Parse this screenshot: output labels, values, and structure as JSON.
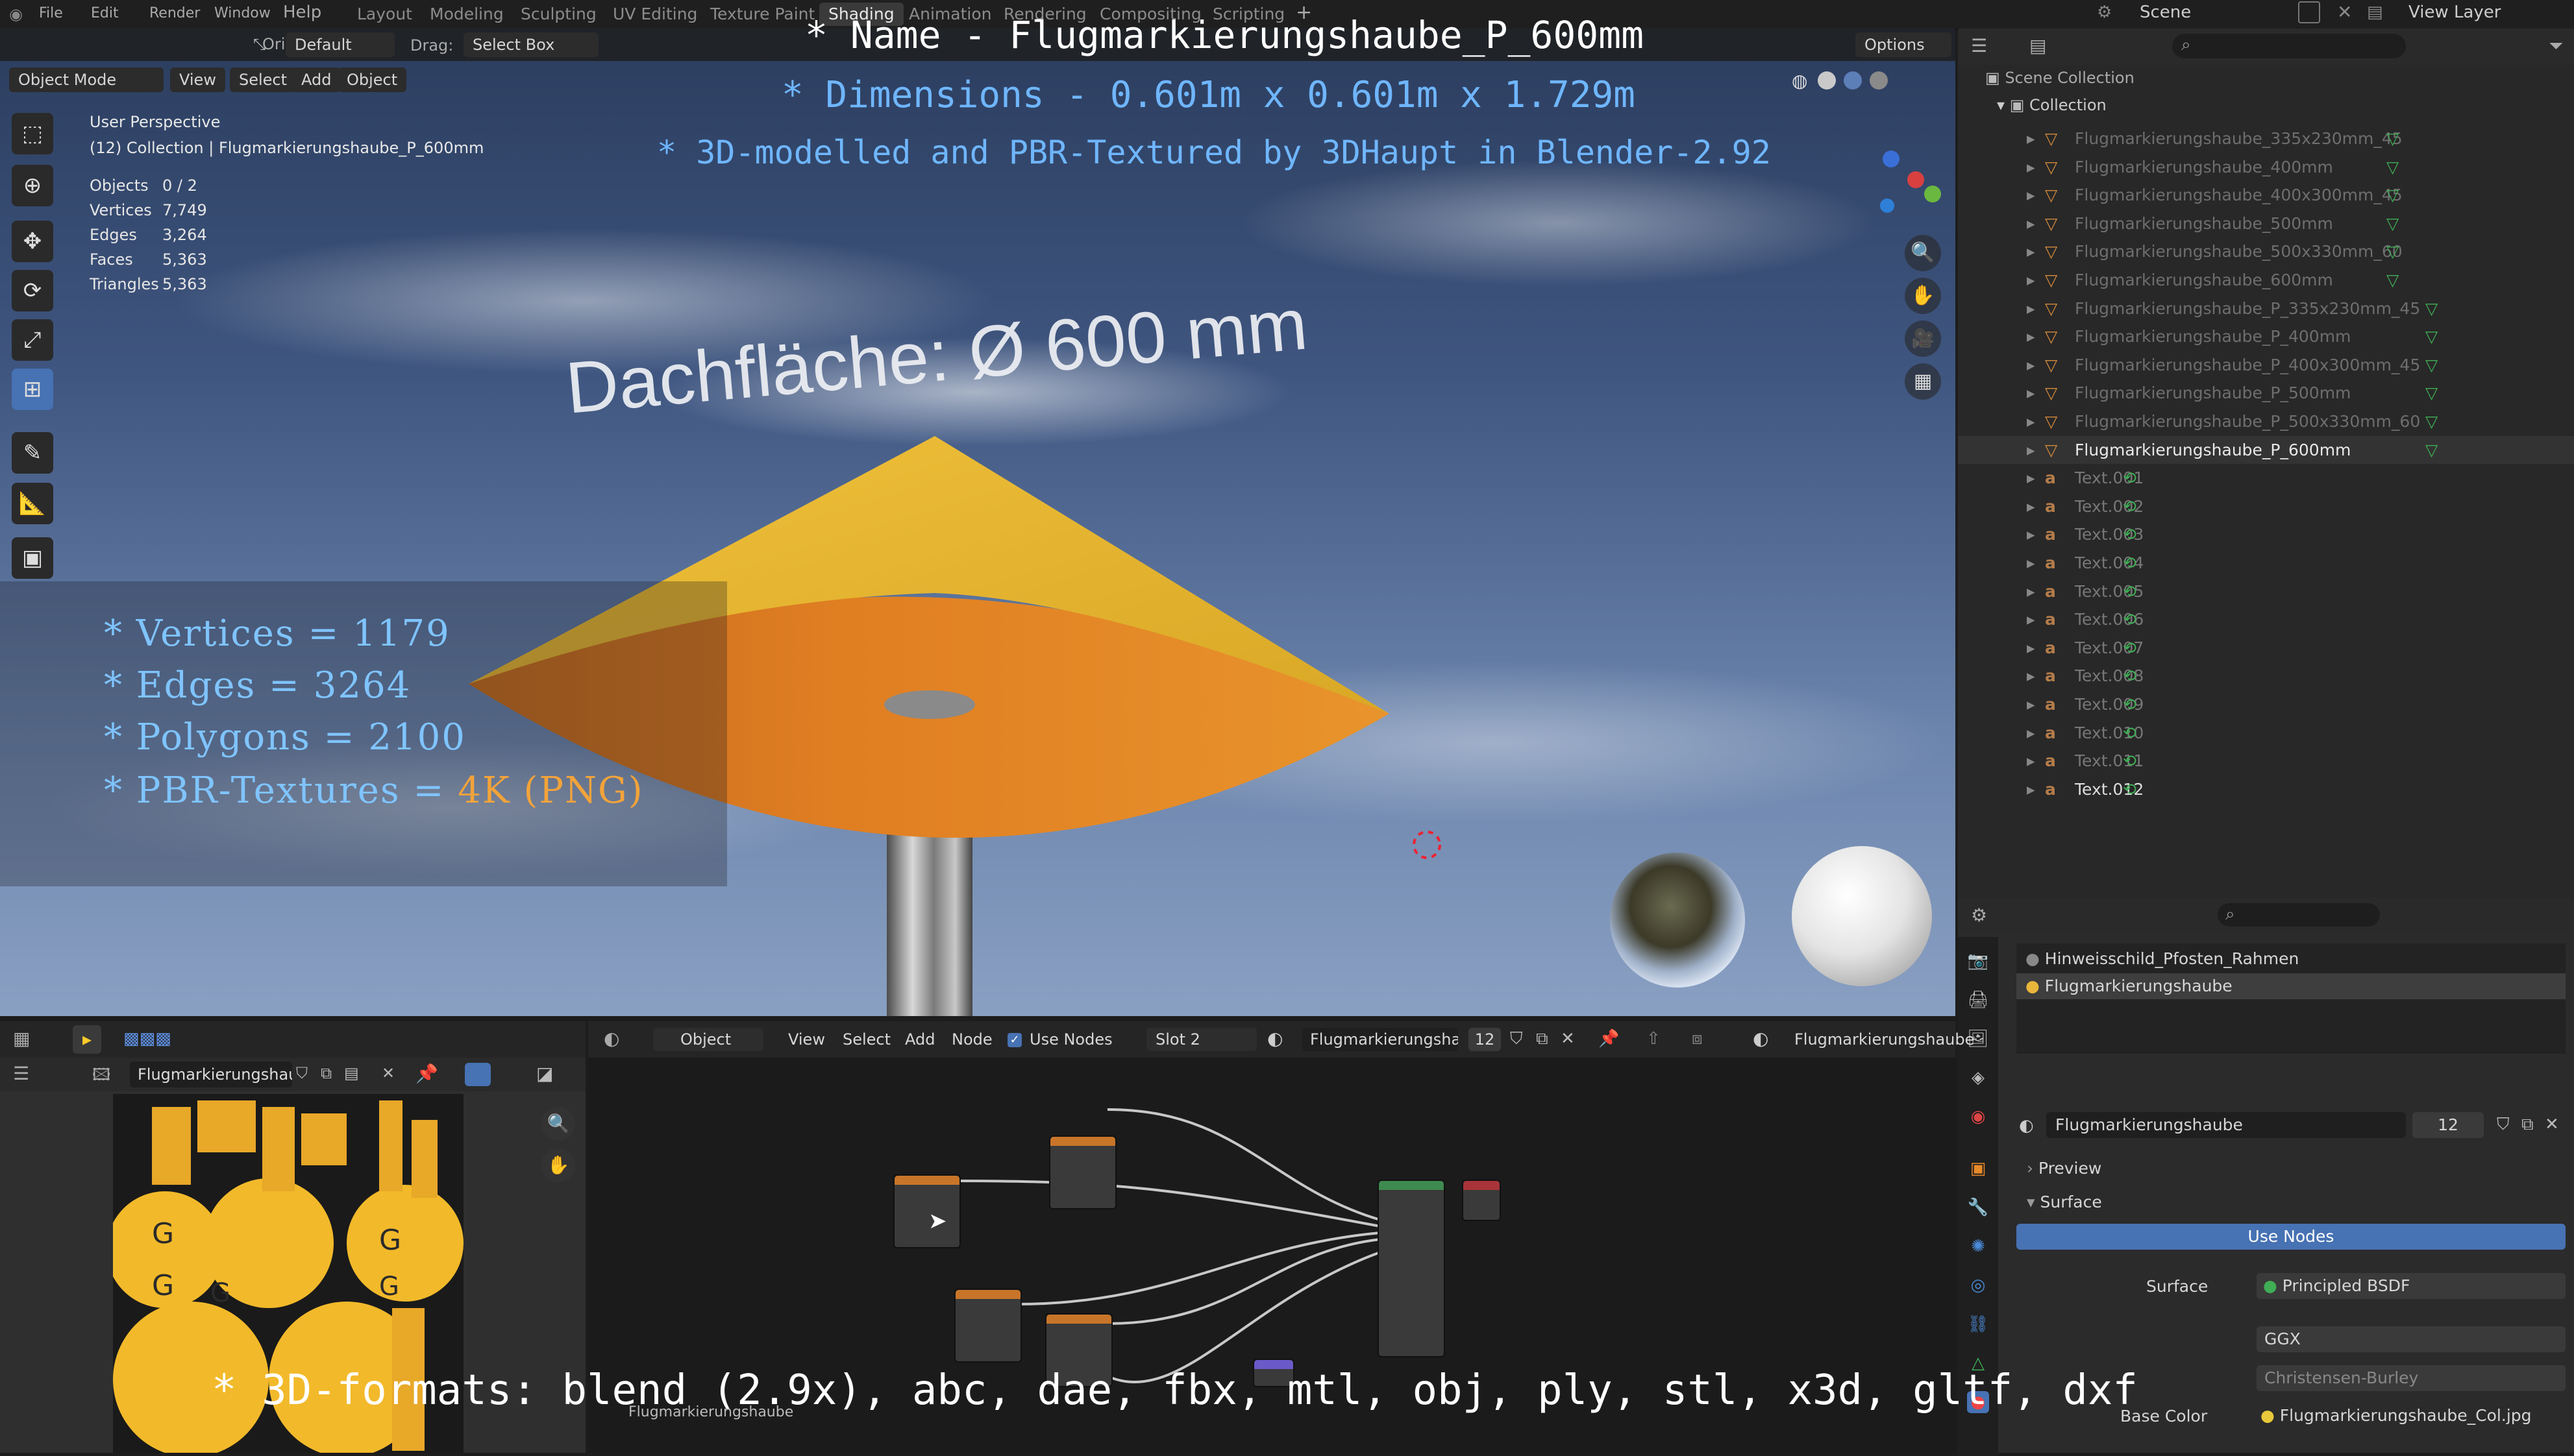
{
  "topbar": {
    "menus": [
      "File",
      "Edit",
      "Render",
      "Window",
      "Help"
    ],
    "workspace_tabs": [
      "Layout",
      "Modeling",
      "Sculpting",
      "UV Editing",
      "Texture Paint",
      "Shading",
      "Animation",
      "Rendering",
      "Compositing",
      "Scripting"
    ],
    "active_tab": "Shading",
    "scene_label": "Scene",
    "view_layer_label": "View Layer"
  },
  "viewport": {
    "header": {
      "mode": "Object Mode",
      "view": "View",
      "select": "Select",
      "add": "Add",
      "object": "Object",
      "orientation_label": "Orientation:",
      "orientation_value": "Default",
      "drag_label": "Drag:",
      "drag_value": "Select Box",
      "options_label": "Options"
    },
    "perspective_label": "User Perspective",
    "collection_label": "(12) Collection | Flugmarkierungshaube_P_600mm",
    "stats": [
      {
        "label": "Objects",
        "value": "0 / 2"
      },
      {
        "label": "Vertices",
        "value": "7,749"
      },
      {
        "label": "Edges",
        "value": "3,264"
      },
      {
        "label": "Faces",
        "value": "5,363"
      },
      {
        "label": "Triangles",
        "value": "5,363"
      }
    ],
    "scene_text_3d": "Dachfläche:  Ø 600 mm",
    "overlay_title": "* Name - Flugmarkierungshaube_P_600mm",
    "overlay_dimensions": "* Dimensions -  0.601m x 0.601m x 1.729m",
    "overlay_credit": "* 3D-modelled and PBR-Textured by 3DHaupt in Blender-2.92",
    "spec_lines": [
      {
        "prefix": "* Vertices = ",
        "value": "1179"
      },
      {
        "prefix": "* Edges = ",
        "value": "3264"
      },
      {
        "prefix": "* Polygons = ",
        "value": "2100"
      },
      {
        "prefix": "* PBR-Textures = ",
        "value": "4K (PNG)"
      }
    ],
    "formats_line": "* 3D-formats: blend (2.9x), abc, dae, fbx, mtl, obj, ply, stl, x3d, gltf, dxf"
  },
  "outliner": {
    "scene_collection": "Scene Collection",
    "collection": "Collection",
    "items": [
      {
        "name": "Flugmarkierungshaube_335x230mm_45",
        "kind": "mesh",
        "state": "dim"
      },
      {
        "name": "Flugmarkierungshaube_400mm",
        "kind": "mesh",
        "state": "dim"
      },
      {
        "name": "Flugmarkierungshaube_400x300mm_45",
        "kind": "mesh",
        "state": "dim"
      },
      {
        "name": "Flugmarkierungshaube_500mm",
        "kind": "mesh",
        "state": "dim"
      },
      {
        "name": "Flugmarkierungshaube_500x330mm_60",
        "kind": "mesh",
        "state": "dim"
      },
      {
        "name": "Flugmarkierungshaube_600mm",
        "kind": "mesh",
        "state": "dim"
      },
      {
        "name": "Flugmarkierungshaube_P_335x230mm_45",
        "kind": "mesh",
        "state": "dim"
      },
      {
        "name": "Flugmarkierungshaube_P_400mm",
        "kind": "mesh",
        "state": "dim"
      },
      {
        "name": "Flugmarkierungshaube_P_400x300mm_45",
        "kind": "mesh",
        "state": "dim"
      },
      {
        "name": "Flugmarkierungshaube_P_500mm",
        "kind": "mesh",
        "state": "dim"
      },
      {
        "name": "Flugmarkierungshaube_P_500x330mm_60",
        "kind": "mesh",
        "state": "dim"
      },
      {
        "name": "Flugmarkierungshaube_P_600mm",
        "kind": "mesh",
        "state": "sel"
      },
      {
        "name": "Text.001",
        "kind": "text",
        "state": "dim"
      },
      {
        "name": "Text.002",
        "kind": "text",
        "state": "dim"
      },
      {
        "name": "Text.003",
        "kind": "text",
        "state": "dim"
      },
      {
        "name": "Text.004",
        "kind": "text",
        "state": "dim"
      },
      {
        "name": "Text.005",
        "kind": "text",
        "state": "dim"
      },
      {
        "name": "Text.006",
        "kind": "text",
        "state": "dim"
      },
      {
        "name": "Text.007",
        "kind": "text",
        "state": "dim"
      },
      {
        "name": "Text.008",
        "kind": "text",
        "state": "dim"
      },
      {
        "name": "Text.009",
        "kind": "text",
        "state": "dim"
      },
      {
        "name": "Text.010",
        "kind": "text",
        "state": "dim"
      },
      {
        "name": "Text.011",
        "kind": "text",
        "state": "dim"
      },
      {
        "name": "Text.012",
        "kind": "text",
        "state": "last"
      }
    ]
  },
  "properties": {
    "material_slots": [
      "Hinweisschild_Pfosten_Rahmen",
      "Flugmarkierungshaube"
    ],
    "material_name": "Flugmarkierungshaube",
    "material_users": "12",
    "preview_label": "Preview",
    "surface_panel": "Surface",
    "use_nodes_button": "Use Nodes",
    "surface_label": "Surface",
    "surface_value": "Principled BSDF",
    "distribution_value": "GGX",
    "subsurface_method_value": "Christensen-Burley",
    "base_color_label": "Base Color",
    "base_color_value": "Flugmarkierungshaube_Col.jpg"
  },
  "image_editor": {
    "image_name": "Flugmarkierungshau...",
    "caption": "Flugmarkierungshaube"
  },
  "node_editor": {
    "object_menu": "Object",
    "view": "View",
    "select": "Select",
    "add": "Add",
    "node": "Node",
    "use_nodes": "Use Nodes",
    "slot": "Slot 2",
    "material_field": "Flugmarkierungshau...",
    "material_users": "12",
    "material_right": "Flugmarkierungshaube"
  },
  "colors": {
    "accent": "#4772b3",
    "sky_top": "#2b3d5e",
    "cone_yellow": "#e7b52c",
    "overlay_blue": "#6fb6ff",
    "overlay_orange": "#f2a33a"
  }
}
